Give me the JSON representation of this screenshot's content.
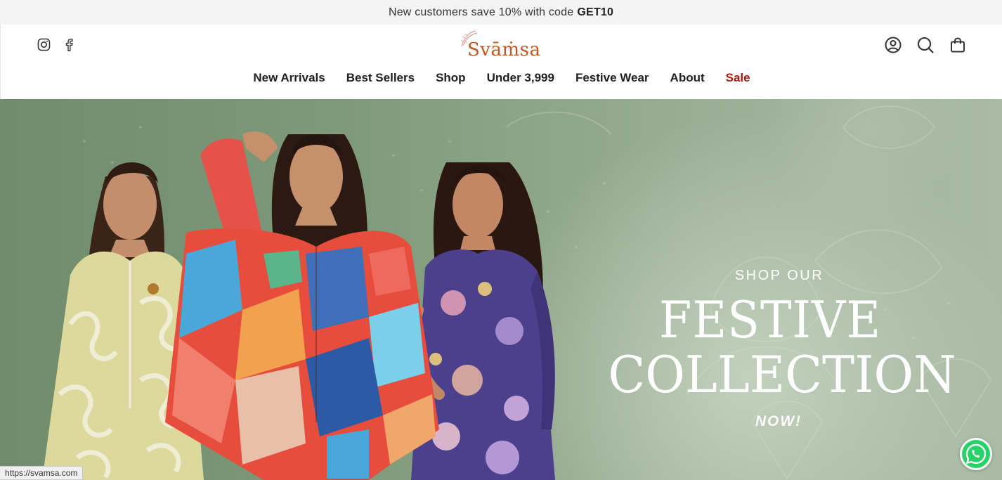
{
  "announcement": {
    "text": "New customers save 10% with code",
    "code": "GET10"
  },
  "brand": {
    "name": "Svamsa",
    "logo_text": "Svāṁsa",
    "color": "#c7551c"
  },
  "header": {
    "social_icons": [
      "instagram-icon",
      "facebook-icon"
    ],
    "utility_icons": [
      "account-icon",
      "search-icon",
      "cart-icon"
    ]
  },
  "nav": {
    "items": [
      {
        "label": "New Arrivals"
      },
      {
        "label": "Best Sellers"
      },
      {
        "label": "Shop"
      },
      {
        "label": "Under 3,999"
      },
      {
        "label": "Festive Wear"
      },
      {
        "label": "About"
      },
      {
        "label": "Sale",
        "color": "#b0140c"
      }
    ]
  },
  "hero": {
    "kicker": "SHOP OUR",
    "title_line1": "FESTIVE",
    "title_line2": "COLLECTION",
    "tag": "NOW!",
    "background_color": "#8fa38b"
  },
  "status_bar": {
    "url": "https://svamsa.com"
  },
  "chat": {
    "icon": "whatsapp-icon",
    "color": "#25d366"
  }
}
